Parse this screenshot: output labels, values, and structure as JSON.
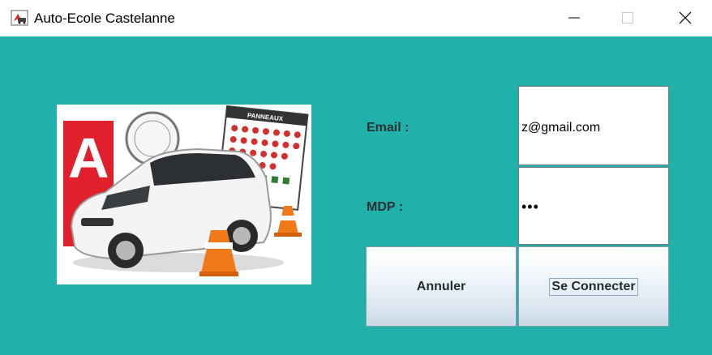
{
  "window": {
    "title": "Auto-Ecole Castelanne",
    "icons": {
      "app": "app-icon",
      "minimize": "minimize-icon",
      "maximize": "maximize-icon",
      "close": "close-icon"
    }
  },
  "illustration": {
    "description_icon": "car-driving-school-image",
    "plate_letter": "A",
    "sign_board_title": "PANNEAUX"
  },
  "form": {
    "email_label": "Email :",
    "email_value": "z@gmail.com",
    "password_label": "MDP :",
    "password_value": "•••",
    "cancel_label": "Annuler",
    "connect_label": "Se Connecter"
  },
  "colors": {
    "background": "#20b2aa",
    "plate_red": "#e0202a",
    "cone_orange": "#f07a1a"
  }
}
